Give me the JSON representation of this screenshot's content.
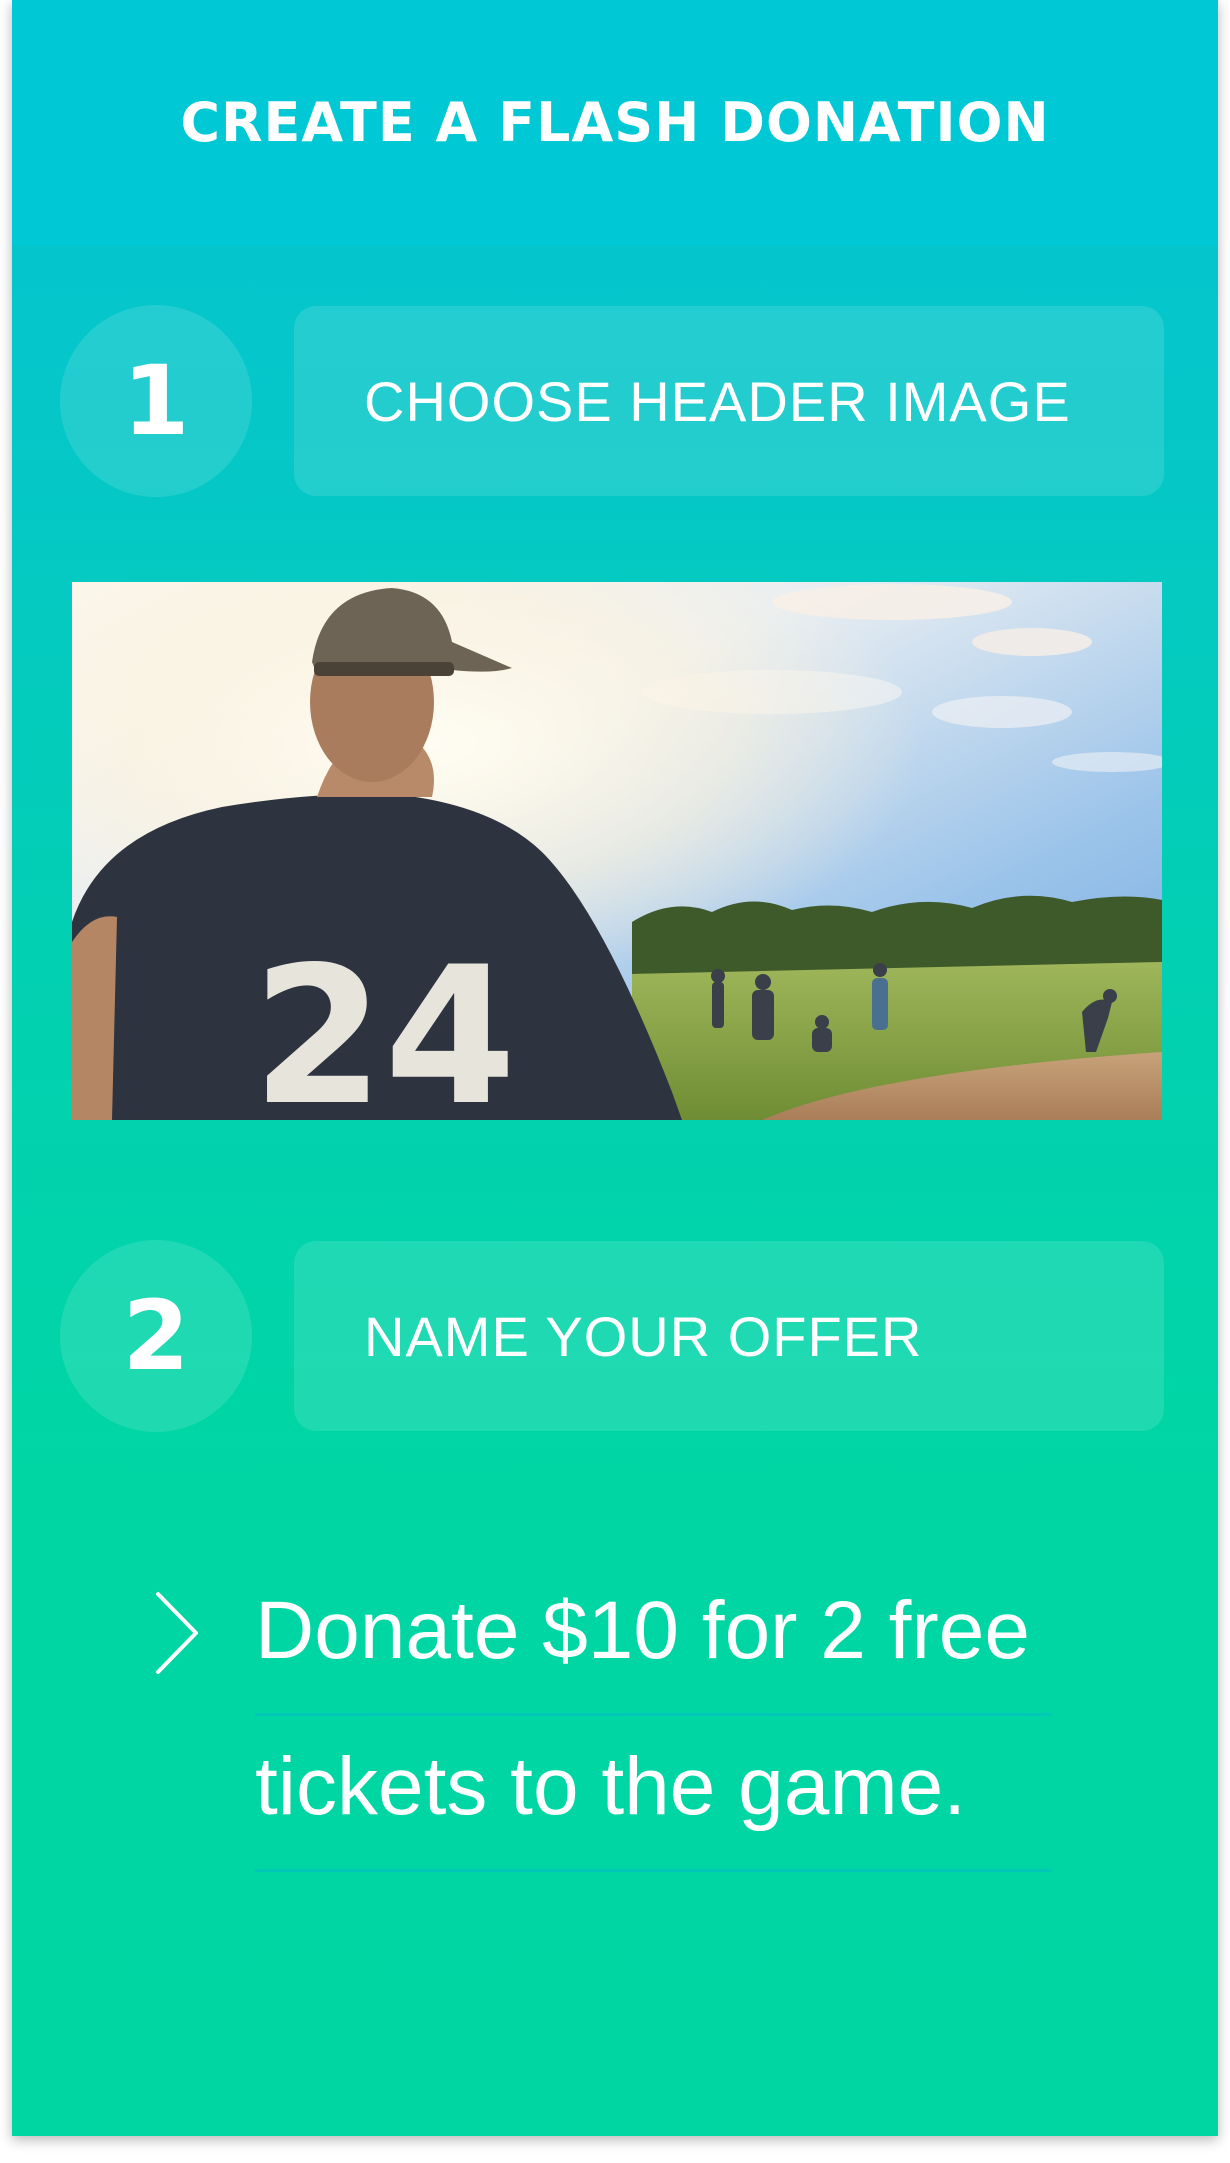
{
  "header": {
    "title": "CREATE A FLASH DONATION"
  },
  "steps": [
    {
      "number": "1",
      "label": "CHOOSE HEADER IMAGE"
    },
    {
      "number": "2",
      "label": "NAME YOUR OFFER"
    }
  ],
  "header_image": {
    "jersey_number": "24"
  },
  "offer": {
    "lines": [
      "Donate $10 for 2 free",
      "tickets to the game."
    ]
  },
  "colors": {
    "header_bg": "#00c8d4",
    "gradient_top": "#04c2d2",
    "gradient_bottom": "#00d6a2",
    "text": "#ffffff"
  },
  "icons": {
    "offer_prompt": "chevron-right-icon"
  }
}
